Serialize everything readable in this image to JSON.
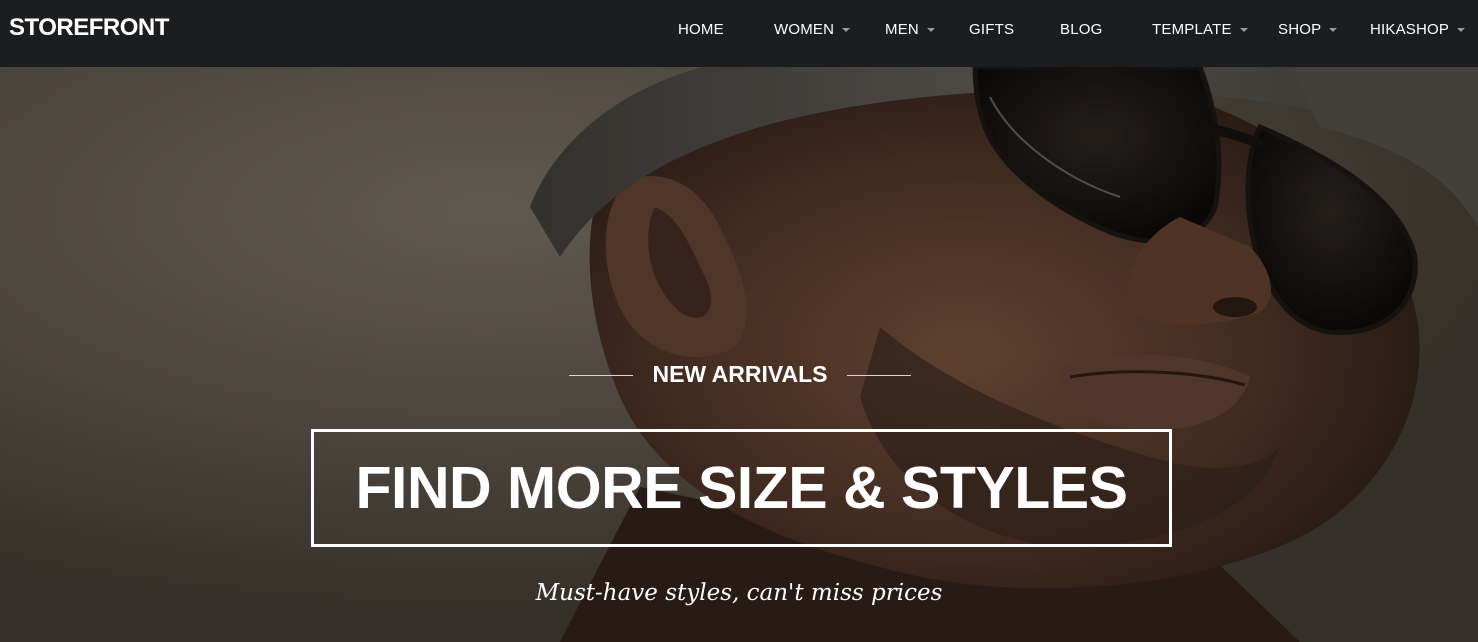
{
  "header": {
    "brand": "STOREFRONT",
    "nav": [
      {
        "label": "HOME",
        "has_dropdown": false
      },
      {
        "label": "WOMEN",
        "has_dropdown": true
      },
      {
        "label": "MEN",
        "has_dropdown": true
      },
      {
        "label": "GIFTS",
        "has_dropdown": false
      },
      {
        "label": "BLOG",
        "has_dropdown": false
      },
      {
        "label": "TEMPLATE",
        "has_dropdown": true
      },
      {
        "label": "SHOP",
        "has_dropdown": true
      },
      {
        "label": "HIKASHOP",
        "has_dropdown": true
      }
    ]
  },
  "hero": {
    "eyebrow": "NEW ARRIVALS",
    "headline": "FIND MORE SIZE & STYLES",
    "tagline": "Must-have styles, can't miss prices"
  },
  "colors": {
    "navbar_bg": "#1c1d1f",
    "text": "#ffffff",
    "caret": "#9a9a9a"
  },
  "icons": {
    "dropdown": "caret-down-icon"
  }
}
